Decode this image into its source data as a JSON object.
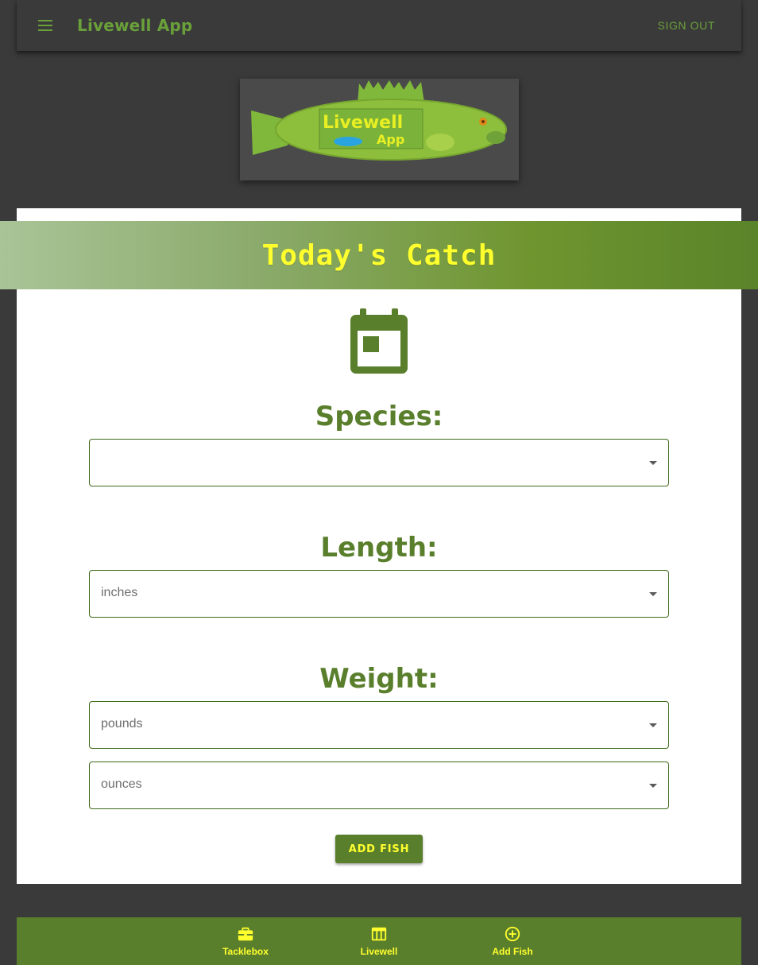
{
  "app": {
    "title": "Livewell App",
    "sign_out_label": "SIGN OUT"
  },
  "logo": {
    "line1": "Livewell",
    "line2": "App"
  },
  "banner": {
    "title": "Today's Catch"
  },
  "form": {
    "species": {
      "label": "Species:",
      "value": ""
    },
    "length": {
      "label": "Length:",
      "value": "inches"
    },
    "weight": {
      "label": "Weight:",
      "pounds_value": "pounds",
      "ounces_value": "ounces"
    },
    "submit_label": "ADD FISH"
  },
  "bottom_nav": {
    "items": [
      {
        "label": "Tacklebox",
        "icon": "toolbox-icon"
      },
      {
        "label": "Livewell",
        "icon": "table-icon"
      },
      {
        "label": "Add Fish",
        "icon": "add-circle-icon"
      }
    ]
  },
  "colors": {
    "accent": "#5a7f2c",
    "title_green": "#6aa03a",
    "highlight_yellow": "#ffff2e",
    "background": "#3a3a3a"
  }
}
